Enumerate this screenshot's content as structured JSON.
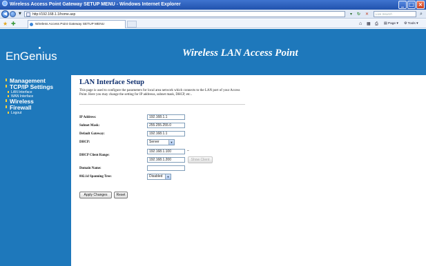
{
  "window": {
    "title": "Wireless Access Point Gateway SETUP MENU - Windows Internet Explorer",
    "controls": [
      "_",
      "□",
      "×"
    ]
  },
  "address_bar": {
    "url": "http://192.168.1.1/home.asp",
    "search_placeholder": "Live Search",
    "icons": [
      "back-icon",
      "forward-icon",
      "refresh-icon",
      "stop-icon",
      "search-icon"
    ]
  },
  "command_bar": {
    "tab_label": "Wireless Access Point Gateway SETUP MENU",
    "home_label": "",
    "feeds_label": "",
    "print_label": "",
    "page_label": "Page",
    "tools_label": "Tools"
  },
  "logo": {
    "text": "EnGenius"
  },
  "banner": {
    "title": "Wireless LAN Access Point"
  },
  "sidebar": {
    "items": [
      {
        "label": "Management",
        "level": "main"
      },
      {
        "label": "TCP/IP Settings",
        "level": "main"
      },
      {
        "label": "LAN Interface",
        "level": "sub"
      },
      {
        "label": "WAN Interface",
        "level": "sub"
      },
      {
        "label": "Wireless",
        "level": "main"
      },
      {
        "label": "Firewall",
        "level": "main"
      },
      {
        "label": "Logout",
        "level": "sub"
      }
    ]
  },
  "main": {
    "title": "LAN Interface Setup",
    "description": "This page is used to configure the parameters for local area network which connects to the LAN port of your Access Point. Here you may change the setting for IP addresss, subnet mask, DHCP, etc..",
    "fields": {
      "ip_address": {
        "label": "IP Address:",
        "value": "192.168.1.1"
      },
      "subnet_mask": {
        "label": "Subnet Mask:",
        "value": "255.255.255.0"
      },
      "default_gateway": {
        "label": "Default Gateway:",
        "value": "192.168.1.1"
      },
      "dhcp": {
        "label": "DHCP:",
        "value": "Server"
      },
      "dhcp_range": {
        "label": "DHCP Client Range:",
        "start": "192.168.1.100",
        "end": "192.168.1.200",
        "separator": "–",
        "show_client": "Show Client"
      },
      "domain_name": {
        "label": "Domain Name:",
        "value": ""
      },
      "spanning_tree": {
        "label": "802.1d Spanning Tree:",
        "value": "Disabled"
      }
    },
    "buttons": {
      "apply": "Apply Changes",
      "reset": "Reset"
    }
  },
  "colors": {
    "brand_blue": "#1e78bb",
    "title_navy": "#0f2f6e",
    "bullet_yellow": "#ffd23a"
  }
}
